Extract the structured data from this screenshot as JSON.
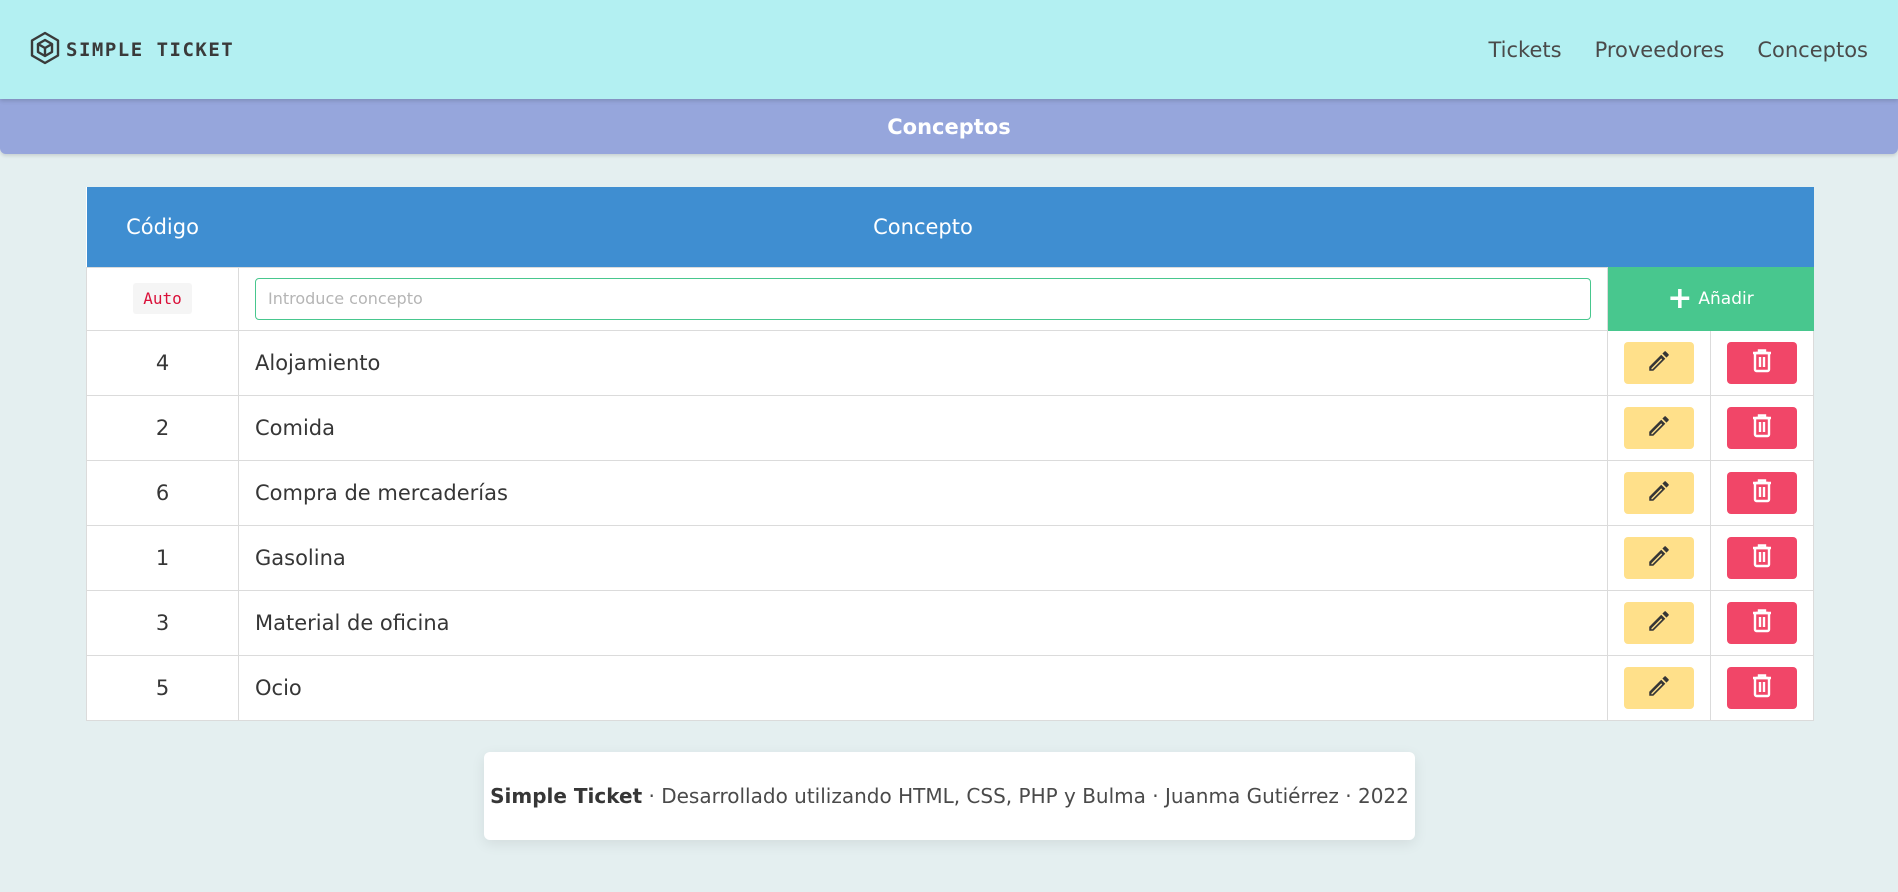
{
  "app": {
    "brand_name": "SIMPLE TICKET",
    "brand_icon": "cube-icon"
  },
  "nav": {
    "items": [
      {
        "label": "Tickets"
      },
      {
        "label": "Proveedores"
      },
      {
        "label": "Conceptos"
      }
    ]
  },
  "banner": {
    "title": "Conceptos"
  },
  "table": {
    "headers": {
      "code": "Código",
      "concept": "Concepto"
    },
    "new_row": {
      "code_tag": "Auto",
      "input_value": "",
      "input_placeholder": "Introduce concepto",
      "add_label": "Añadir"
    },
    "rows": [
      {
        "code": "4",
        "concept": "Alojamiento"
      },
      {
        "code": "2",
        "concept": "Comida"
      },
      {
        "code": "6",
        "concept": "Compra de mercaderías"
      },
      {
        "code": "1",
        "concept": "Gasolina"
      },
      {
        "code": "3",
        "concept": "Material de oficina"
      },
      {
        "code": "5",
        "concept": "Ocio"
      }
    ]
  },
  "footer": {
    "brand": "Simple Ticket",
    "text": " · Desarrollado utilizando HTML, CSS, PHP y Bulma · Juanma Gutiérrez · 2022"
  },
  "colors": {
    "navbar": "#b3f0f2",
    "banner": "#96a6dc",
    "table_header": "#3f8ed1",
    "add_button": "#48c78e",
    "edit_button": "#ffe08a",
    "delete_button": "#f14668"
  }
}
